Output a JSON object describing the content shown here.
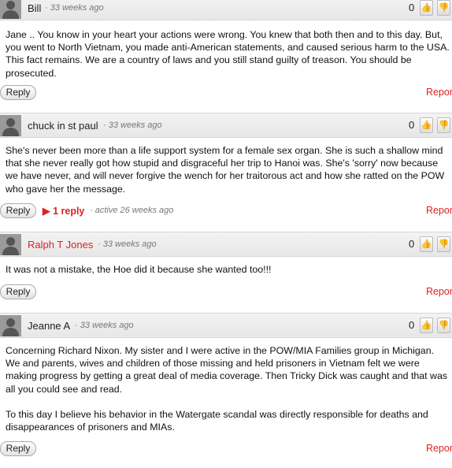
{
  "comments": [
    {
      "author": "Bill",
      "time": "· 33 weeks ago",
      "score": "0",
      "body": [
        "Jane .. You know in your heart your actions were wrong. You knew that both then and to this day. But, you went to North Vietnam, you made anti-American statements, and caused serious harm to the USA. This fact remains. We are a country of laws and you still stand guilty of treason. You should be prosecuted."
      ],
      "reply_label": "Reply",
      "report_label": "Report"
    },
    {
      "author": "chuck in st paul",
      "time": "· 33 weeks ago",
      "score": "0",
      "body": [
        "She's never been more than a life support system for a female sex organ. She is such a shallow mind that she never really got how stupid and disgraceful her trip to Hanoi was. She's 'sorry' now because we have never, and will never forgive the wench for her traitorous act and how she ratted on the POW who gave her the message."
      ],
      "reply_label": "Reply",
      "replies_label": "▶ 1 reply",
      "active_label": "· active 26 weeks ago",
      "report_label": "Report"
    },
    {
      "author": "Ralph T Jones",
      "time": "· 33 weeks ago",
      "score": "0",
      "body": [
        "It was not a mistake, the Hoe did it because she wanted too!!!"
      ],
      "reply_label": "Reply",
      "report_label": "Report"
    },
    {
      "author": "Jeanne A",
      "time": "· 33 weeks ago",
      "score": "0",
      "body": [
        "Concerning Richard Nixon. My sister and I were active in the POW/MIA Families group in Michigan. We and parents, wives and children of those missing and held prisoners in Vietnam felt we were making progress by getting a great deal of media coverage. Then Tricky Dick was caught and that was all you could see and read.",
        "To this day I believe his behavior in the Watergate scandal was directly responsible for deaths and disappearances of prisoners and MIAs."
      ],
      "reply_label": "Reply",
      "report_label": "Report"
    }
  ],
  "icons": {
    "avatar": "default-avatar-icon",
    "like": "thumbs-up-icon",
    "dislike": "thumbs-down-icon"
  },
  "colors": {
    "author_link": "#dd2222",
    "report_link": "#dd2222"
  }
}
